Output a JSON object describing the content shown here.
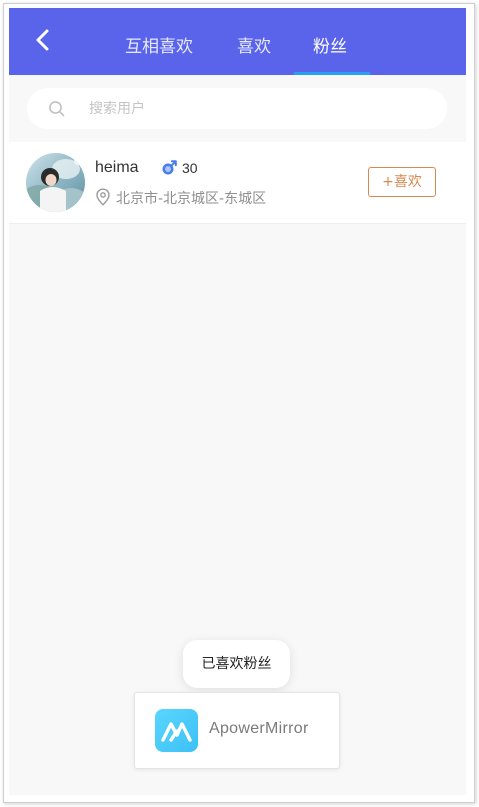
{
  "header": {
    "back_icon": "chevron-left-icon",
    "tabs": [
      {
        "label": "互相喜欢",
        "active": false
      },
      {
        "label": "喜欢",
        "active": false
      },
      {
        "label": "粉丝",
        "active": true
      }
    ],
    "bar_color": "#5a64ea",
    "underline_color": "#27a0f0"
  },
  "search": {
    "placeholder": "搜索用户",
    "value": "",
    "icon": "search-icon"
  },
  "fans": [
    {
      "name": "heima",
      "gender_icon": "male-icon",
      "age": "30",
      "location": "北京市-北京城区-东城区",
      "action_label": "+喜欢",
      "action_color": "#d8894f"
    }
  ],
  "toast": {
    "text": "已喜欢粉丝"
  },
  "overlay": {
    "app_name": "ApowerMirror",
    "logo_color": "#3cc0f5"
  }
}
